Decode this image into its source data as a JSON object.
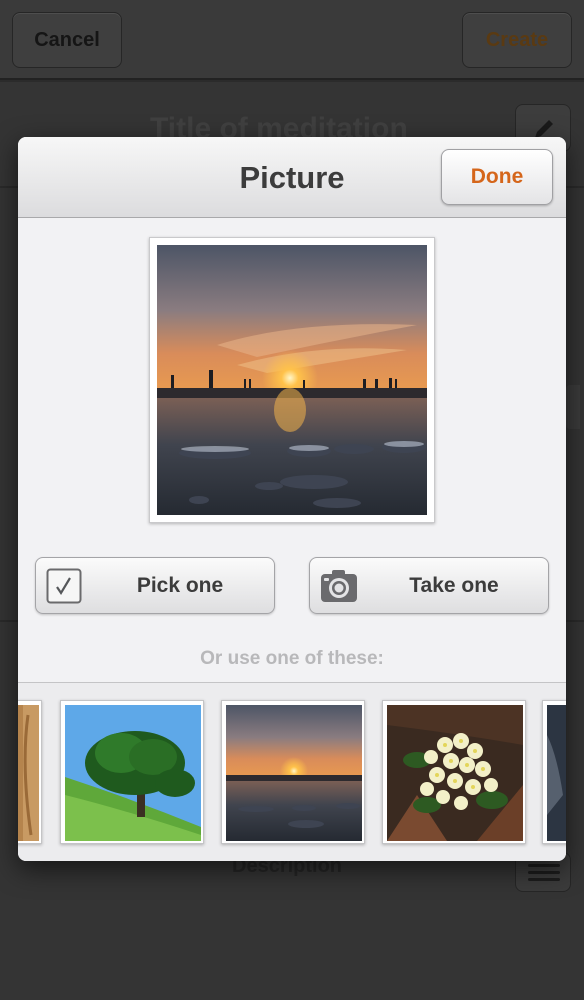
{
  "background": {
    "cancel_label": "Cancel",
    "create_label": "Create",
    "title_placeholder": "Title of meditation",
    "description_label": "Description"
  },
  "modal": {
    "title": "Picture",
    "done_label": "Done",
    "pick_label": "Pick one",
    "take_label": "Take one",
    "hint": "Or use one of these:"
  },
  "thumbnails": [
    {
      "name": "wood",
      "partial": true
    },
    {
      "name": "tree-on-hill"
    },
    {
      "name": "sunset-beach",
      "selected": true
    },
    {
      "name": "primrose-flowers"
    },
    {
      "name": "dark-sky",
      "partial": true
    }
  ],
  "colors": {
    "accent": "#d5661b",
    "hint_text": "#b8b8ba"
  },
  "icons": [
    "pencil-icon",
    "checkbox-icon",
    "camera-icon",
    "menu-icon"
  ]
}
